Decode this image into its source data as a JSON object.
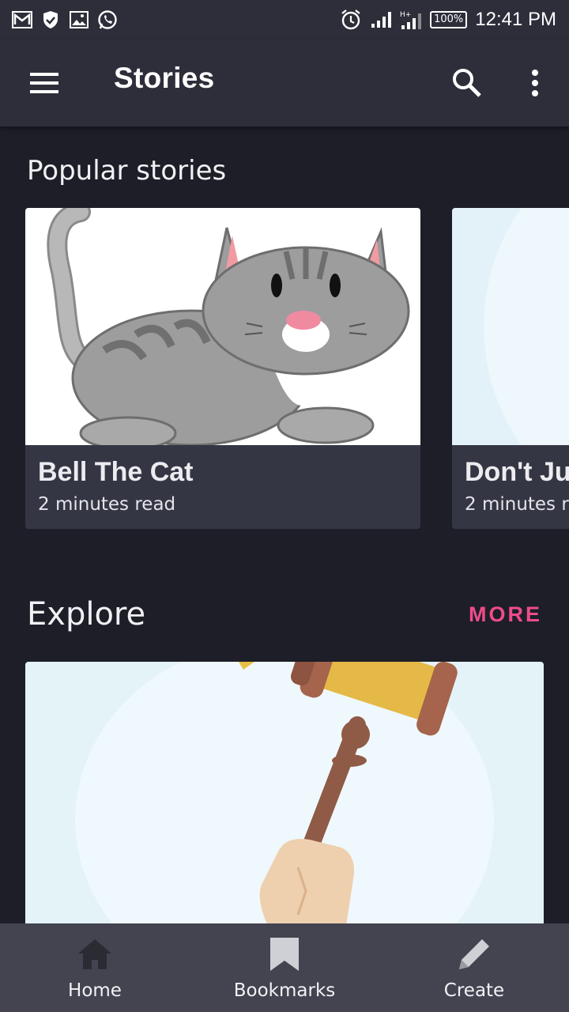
{
  "status_bar": {
    "battery": "100%",
    "time": "12:41 PM",
    "left_icons": [
      "gmail-icon",
      "shield-icon",
      "gallery-icon",
      "whatsapp-icon"
    ],
    "right_icons": [
      "alarm-icon",
      "signal-icon",
      "signal-h-plus-icon",
      "battery-icon"
    ]
  },
  "app_bar": {
    "title": "Stories",
    "icons": [
      "menu-icon",
      "search-icon",
      "more-vert-icon"
    ]
  },
  "popular": {
    "title": "Popular stories",
    "cards": [
      {
        "title": "Bell The Cat",
        "subtitle": "2 minutes read",
        "image": "cat-illustration"
      },
      {
        "title": "Don't Ju",
        "subtitle": "2 minutes r",
        "image": "light-blue-illustration"
      }
    ]
  },
  "explore": {
    "title": "Explore",
    "more_label": "MORE",
    "image": "gavel-illustration"
  },
  "bottom_nav": {
    "items": [
      {
        "label": "Home",
        "icon": "home-icon"
      },
      {
        "label": "Bookmarks",
        "icon": "bookmark-icon"
      },
      {
        "label": "Create",
        "icon": "pencil-icon"
      }
    ]
  },
  "colors": {
    "background": "#1d1e27",
    "app_bar": "#2d2e3a",
    "card": "#353644",
    "accent": "#ee4c88",
    "bottom_nav": "#43444f"
  }
}
